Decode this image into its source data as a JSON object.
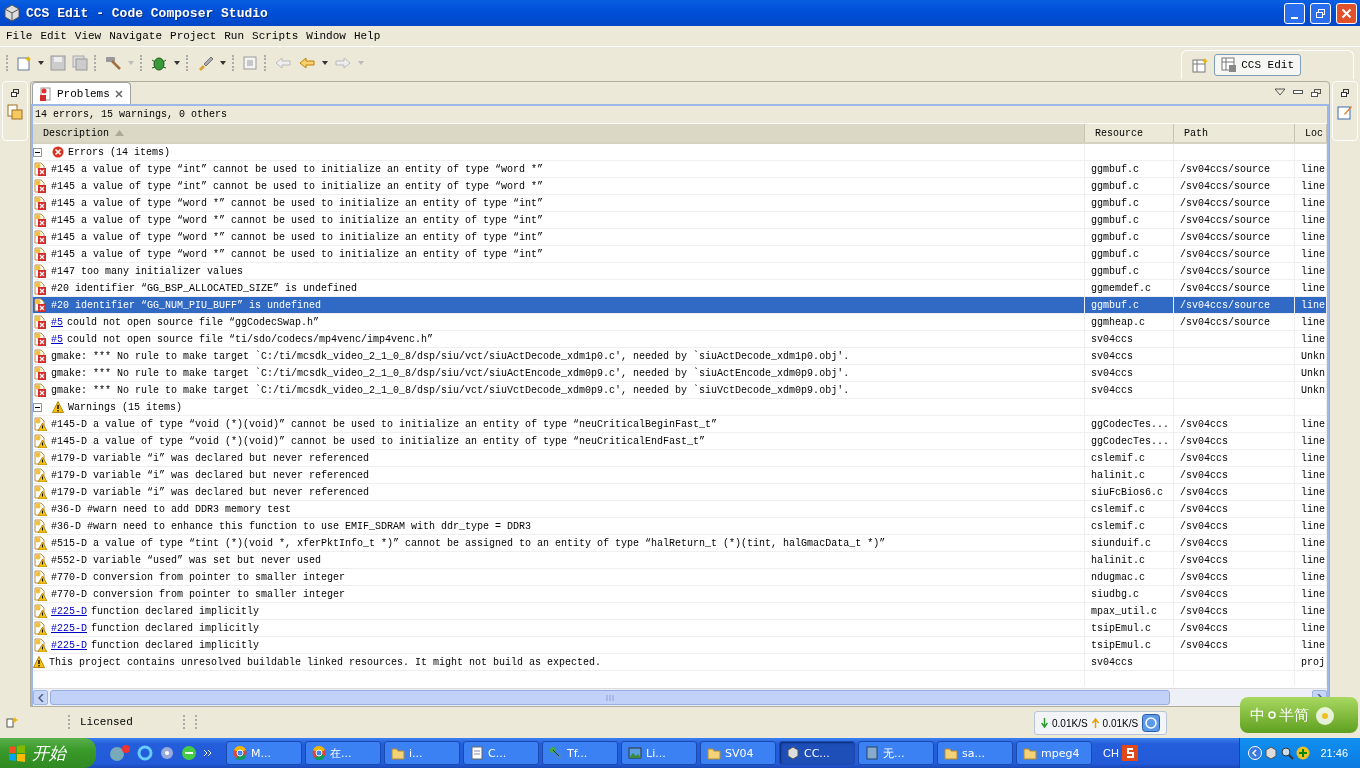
{
  "window": {
    "title": "CCS Edit - Code Composer Studio"
  },
  "menu": [
    "File",
    "Edit",
    "View",
    "Navigate",
    "Project",
    "Run",
    "Scripts",
    "Window",
    "Help"
  ],
  "perspective": {
    "label": "CCS Edit"
  },
  "problems": {
    "tab": "Problems",
    "summary": "14 errors, 15 warnings, 0 others",
    "columns": [
      {
        "label": "Description",
        "sorted": true
      },
      {
        "label": "Resource",
        "sorted": false
      },
      {
        "label": "Path",
        "sorted": false
      },
      {
        "label": "Loc",
        "sorted": false
      }
    ],
    "groups": [
      {
        "kind": "error",
        "label": "Errors (14 items)",
        "expanded": true,
        "items": [
          {
            "kind": "error",
            "description": "#145 a value of type “int” cannot be used to initialize an entity of type “word *”",
            "resource": "ggmbuf.c",
            "path": "/sv04ccs/source",
            "location": "line",
            "selected": false
          },
          {
            "kind": "error",
            "description": "#145 a value of type “int” cannot be used to initialize an entity of type “word *”",
            "resource": "ggmbuf.c",
            "path": "/sv04ccs/source",
            "location": "line",
            "selected": false
          },
          {
            "kind": "error",
            "description": "#145 a value of type “word *” cannot be used to initialize an entity of type “int”",
            "resource": "ggmbuf.c",
            "path": "/sv04ccs/source",
            "location": "line",
            "selected": false
          },
          {
            "kind": "error",
            "description": "#145 a value of type “word *” cannot be used to initialize an entity of type “int”",
            "resource": "ggmbuf.c",
            "path": "/sv04ccs/source",
            "location": "line",
            "selected": false
          },
          {
            "kind": "error",
            "description": "#145 a value of type “word *” cannot be used to initialize an entity of type “int”",
            "resource": "ggmbuf.c",
            "path": "/sv04ccs/source",
            "location": "line",
            "selected": false
          },
          {
            "kind": "error",
            "description": "#145 a value of type “word *” cannot be used to initialize an entity of type “int”",
            "resource": "ggmbuf.c",
            "path": "/sv04ccs/source",
            "location": "line",
            "selected": false
          },
          {
            "kind": "error",
            "description": "#147 too many initializer values",
            "resource": "ggmbuf.c",
            "path": "/sv04ccs/source",
            "location": "line",
            "selected": false
          },
          {
            "kind": "error",
            "description": "#20 identifier “GG_BSP_ALLOCATED_SIZE” is undefined",
            "resource": "ggmemdef.c",
            "path": "/sv04ccs/source",
            "location": "line",
            "selected": false
          },
          {
            "kind": "error",
            "description": "#20 identifier “GG_NUM_PIU_BUFF” is undefined",
            "resource": "ggmbuf.c",
            "path": "/sv04ccs/source",
            "location": "line",
            "selected": true
          },
          {
            "kind": "error",
            "link": "#5",
            "description": "could not open source file “ggCodecSwap.h”",
            "resource": "ggmheap.c",
            "path": "/sv04ccs/source",
            "location": "line",
            "selected": false
          },
          {
            "kind": "error",
            "link": "#5",
            "description": "could not open source file “ti/sdo/codecs/mp4venc/imp4venc.h”",
            "resource": "sv04ccs",
            "location": "line",
            "selected": false
          },
          {
            "kind": "error",
            "description": "gmake: *** No rule to make target `C:/ti/mcsdk_video_2_1_0_8/dsp/siu/vct/siuActDecode_xdm1p0.c', needed by `siuActDecode_xdm1p0.obj'.",
            "resource": "sv04ccs",
            "location": "Unkn",
            "selected": false
          },
          {
            "kind": "error",
            "description": "gmake: *** No rule to make target `C:/ti/mcsdk_video_2_1_0_8/dsp/siu/vct/siuActEncode_xdm0p9.c', needed by `siuActEncode_xdm0p9.obj'.",
            "resource": "sv04ccs",
            "location": "Unkn",
            "selected": false
          },
          {
            "kind": "error",
            "description": "gmake: *** No rule to make target `C:/ti/mcsdk_video_2_1_0_8/dsp/siu/vct/siuVctDecode_xdm0p9.c', needed by `siuVctDecode_xdm0p9.obj'.",
            "resource": "sv04ccs",
            "location": "Unkn",
            "selected": false
          }
        ]
      },
      {
        "kind": "warning",
        "label": "Warnings (15 items)",
        "expanded": true,
        "items": [
          {
            "kind": "warning",
            "description": "#145-D a value of type “void (*)(void)” cannot be used to initialize an entity of type “neuCriticalBeginFast_t”",
            "resource": "ggCodecTes...",
            "path": "/sv04ccs",
            "location": "line",
            "selected": false
          },
          {
            "kind": "warning",
            "description": "#145-D a value of type “void (*)(void)” cannot be used to initialize an entity of type “neuCriticalEndFast_t”",
            "resource": "ggCodecTes...",
            "path": "/sv04ccs",
            "location": "line",
            "selected": false
          },
          {
            "kind": "warning",
            "description": "#179-D variable “i” was declared but never referenced",
            "resource": "cslemif.c",
            "path": "/sv04ccs",
            "location": "line",
            "selected": false
          },
          {
            "kind": "warning",
            "description": "#179-D variable “i” was declared but never referenced",
            "resource": "halinit.c",
            "path": "/sv04ccs",
            "location": "line",
            "selected": false
          },
          {
            "kind": "warning",
            "description": "#179-D variable “i” was declared but never referenced",
            "resource": "siuFcBios6.c",
            "path": "/sv04ccs",
            "location": "line",
            "selected": false
          },
          {
            "kind": "warning",
            "description": "#36-D #warn need to add DDR3 memory test",
            "resource": "cslemif.c",
            "path": "/sv04ccs",
            "location": "line",
            "selected": false
          },
          {
            "kind": "warning",
            "description": "#36-D #warn need to enhance this function to use EMIF_SDRAM with ddr_type = DDR3",
            "resource": "cslemif.c",
            "path": "/sv04ccs",
            "location": "line",
            "selected": false
          },
          {
            "kind": "warning",
            "description": "#515-D a value of type “tint (*)(void *, xferPktInfo_t *)” cannot be assigned to an entity of type “halReturn_t (*)(tint, halGmacData_t *)”",
            "resource": "siunduif.c",
            "path": "/sv04ccs",
            "location": "line",
            "selected": false
          },
          {
            "kind": "warning",
            "description": "#552-D variable “used” was set but never used",
            "resource": "halinit.c",
            "path": "/sv04ccs",
            "location": "line",
            "selected": false
          },
          {
            "kind": "warning",
            "description": "#770-D conversion from pointer to smaller integer",
            "resource": "ndugmac.c",
            "path": "/sv04ccs",
            "location": "line",
            "selected": false
          },
          {
            "kind": "warning",
            "description": "#770-D conversion from pointer to smaller integer",
            "resource": "siudbg.c",
            "path": "/sv04ccs",
            "location": "line",
            "selected": false
          },
          {
            "kind": "warning",
            "link": "#225-D",
            "description": "function declared implicitly",
            "resource": "mpax_util.c",
            "path": "/sv04ccs",
            "location": "line",
            "selected": false
          },
          {
            "kind": "warning",
            "link": "#225-D",
            "description": "function declared implicitly",
            "resource": "tsipEmul.c",
            "path": "/sv04ccs",
            "location": "line",
            "selected": false
          },
          {
            "kind": "warning",
            "link": "#225-D",
            "description": "function declared implicitly",
            "resource": "tsipEmul.c",
            "path": "/sv04ccs",
            "location": "line",
            "selected": false
          },
          {
            "kind": "project_warning",
            "description": "This project contains unresolved buildable linked resources. It might not build as expected.",
            "resource": "sv04ccs",
            "location": "proj",
            "selected": false
          }
        ]
      }
    ]
  },
  "status_bar": {
    "text": "Licensed",
    "download": "0.01K/S",
    "upload": "0.01K/S"
  },
  "ime": {
    "language": "中",
    "mode": "半简"
  },
  "taskbar": {
    "start": "开始",
    "tasks": [
      {
        "label": "M...",
        "kind": "browser",
        "selected": false
      },
      {
        "label": "在...",
        "kind": "browser",
        "selected": false
      },
      {
        "label": "i...",
        "kind": "folder",
        "selected": false
      },
      {
        "label": "C...",
        "kind": "notepad",
        "selected": false
      },
      {
        "label": "Tf...",
        "kind": "network",
        "selected": false
      },
      {
        "label": "Li...",
        "kind": "image",
        "selected": false
      },
      {
        "label": "SV04",
        "kind": "folder",
        "selected": false
      },
      {
        "label": "CC...",
        "kind": "cube",
        "selected": true
      },
      {
        "label": "无...",
        "kind": "document",
        "selected": false
      },
      {
        "label": "sa...",
        "kind": "folder",
        "selected": false
      },
      {
        "label": "mpeg4",
        "kind": "folder",
        "selected": false
      }
    ],
    "language": "CH",
    "clock": "21:46"
  }
}
